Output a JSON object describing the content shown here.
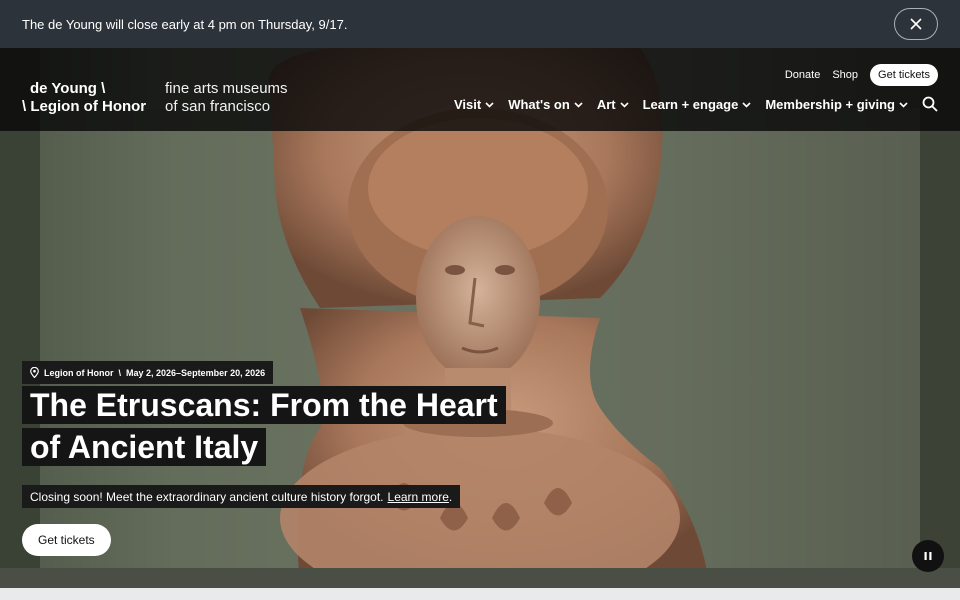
{
  "alert": {
    "text": "The de Young will close early at 4 pm on Thursday, 9/17.",
    "close_icon": "close-icon"
  },
  "header": {
    "logo": {
      "line1": "de Young \\",
      "line2": "\\ Legion of Honor"
    },
    "tagline": {
      "line1": "fine arts museums",
      "line2": "of san francisco"
    },
    "utility": {
      "donate": "Donate",
      "shop": "Shop",
      "tickets": "Get tickets"
    },
    "nav": [
      {
        "label": "Visit"
      },
      {
        "label": "What's on"
      },
      {
        "label": "Art"
      },
      {
        "label": "Learn + engage"
      },
      {
        "label": "Membership + giving"
      }
    ],
    "search_icon": "search-icon"
  },
  "hero": {
    "location": "Legion of Honor",
    "dates": "May 2, 2026–September 20, 2026",
    "title_line1": "The Etruscans: From the Heart",
    "title_line2": "of Ancient Italy",
    "description": "Closing soon! Meet the extraordinary ancient culture history forgot.",
    "learn_more": "Learn more",
    "description_end": ".",
    "cta": "Get tickets",
    "pause_icon": "pause-icon",
    "location_icon": "map-pin-icon"
  },
  "colors": {
    "alert_bg": "#2d333b",
    "header_bg": "#0a0a0a",
    "label_bg": "#151515"
  }
}
